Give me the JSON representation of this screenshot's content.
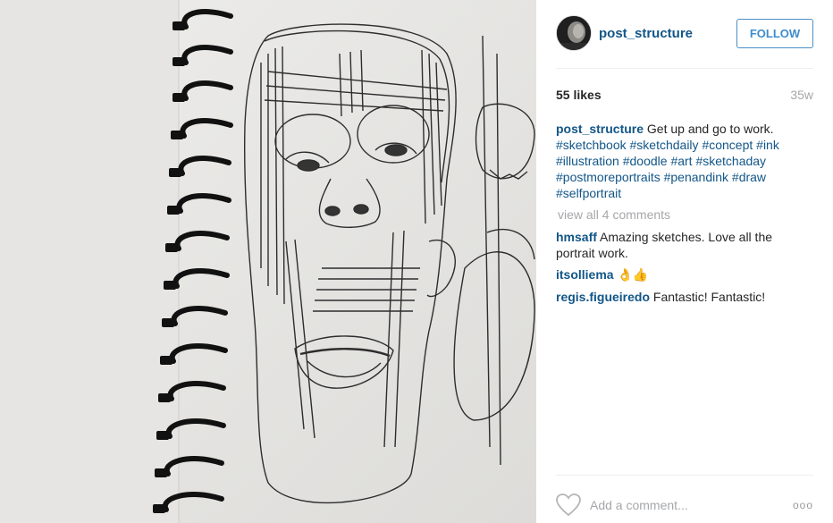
{
  "post": {
    "username": "post_structure",
    "follow_label": "FOLLOW",
    "likes": "55 likes",
    "age": "35w"
  },
  "caption": {
    "user": "post_structure",
    "text": "Get up and go to work.",
    "tags": [
      "#sketchbook",
      "#sketchdaily",
      "#concept",
      "#ink",
      "#illustration",
      "#doodle",
      "#art",
      "#sketchaday",
      "#postmoreportraits",
      "#penandink",
      "#draw",
      "#selfportrait"
    ]
  },
  "view_all": "view all 4 comments",
  "comments": [
    {
      "user": "hmsaff",
      "text": "Amazing sketches. Love all the portrait work."
    },
    {
      "user": "itsolliema",
      "text": "👌👍"
    },
    {
      "user": "regis.figueiredo",
      "text": "Fantastic! Fantastic!"
    }
  ],
  "footer": {
    "add_comment_placeholder": "Add a comment...",
    "more_label": "ooo"
  },
  "icons": {
    "like": "heart-icon",
    "more": "more-options-icon"
  }
}
